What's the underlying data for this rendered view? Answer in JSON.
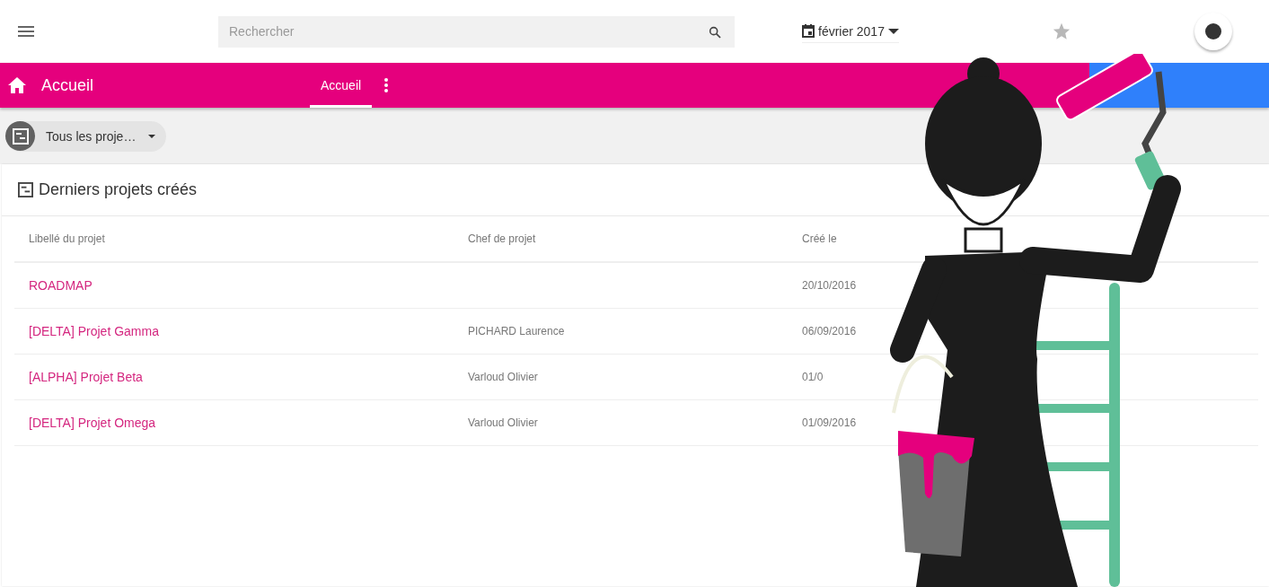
{
  "top_bar": {
    "search": {
      "placeholder": "Rechercher"
    },
    "date_picker": {
      "value": "février 2017"
    },
    "favorite": {
      "on": false
    }
  },
  "header": {
    "title": "Accueil",
    "tabs": [
      {
        "label": "Accueil",
        "selected": true
      }
    ]
  },
  "filter": {
    "value": "Tous les proje…"
  },
  "card": {
    "title": "Derniers projets créés",
    "table": {
      "columns": [
        "Libellé du projet",
        "Chef de projet",
        "Créé le"
      ],
      "rows": [
        {
          "project": "ROADMAP",
          "created": "20/10/2016"
        },
        {
          "project": "[DELTA] Projet Gamma",
          "manager": "PICHARD Laurence",
          "created": "06/09/2016"
        },
        {
          "project": "[ALPHA] Projet Beta",
          "manager": "Varloud Olivier",
          "created": "01/0"
        },
        {
          "project": "[DELTA] Projet Omega",
          "manager": "Varloud Olivier",
          "created": "01/09/2016"
        }
      ]
    }
  }
}
